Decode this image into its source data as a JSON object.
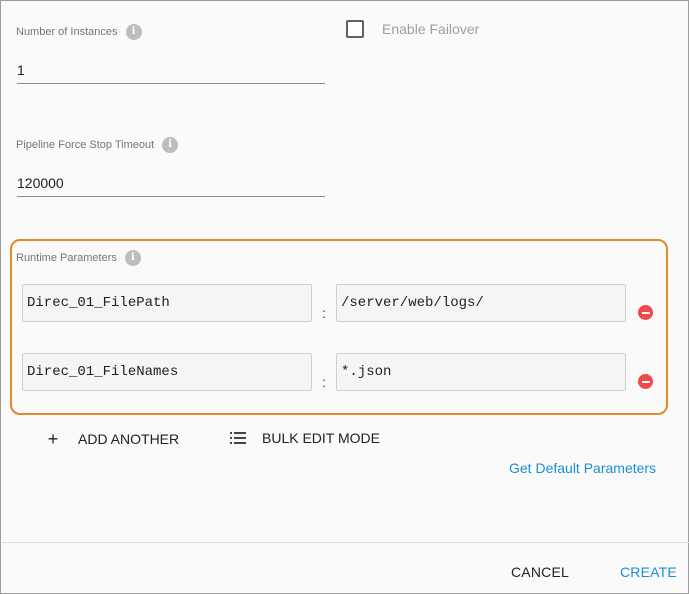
{
  "instances": {
    "label": "Number of Instances",
    "value": "1"
  },
  "failover": {
    "label": "Enable Failover",
    "checked": false
  },
  "timeout": {
    "label": "Pipeline Force Stop Timeout",
    "value": "120000"
  },
  "runtime": {
    "label": "Runtime Parameters",
    "separator": ":",
    "params": [
      {
        "key": "Direc_01_FilePath",
        "value": "/server/web/logs/"
      },
      {
        "key": "Direc_01_FileNames",
        "value": "*.json"
      }
    ]
  },
  "actions": {
    "add_another": "ADD ANOTHER",
    "bulk_edit": "BULK EDIT MODE",
    "get_defaults": "Get Default Parameters"
  },
  "footer": {
    "cancel": "CANCEL",
    "create": "CREATE"
  },
  "colors": {
    "highlight_border": "#e08a2c",
    "link": "#1a8fd6",
    "remove": "#ef4a4a"
  },
  "icons": {
    "info": "info-icon",
    "add": "plus-icon",
    "bulk": "list-icon",
    "remove": "remove-circle-icon"
  }
}
